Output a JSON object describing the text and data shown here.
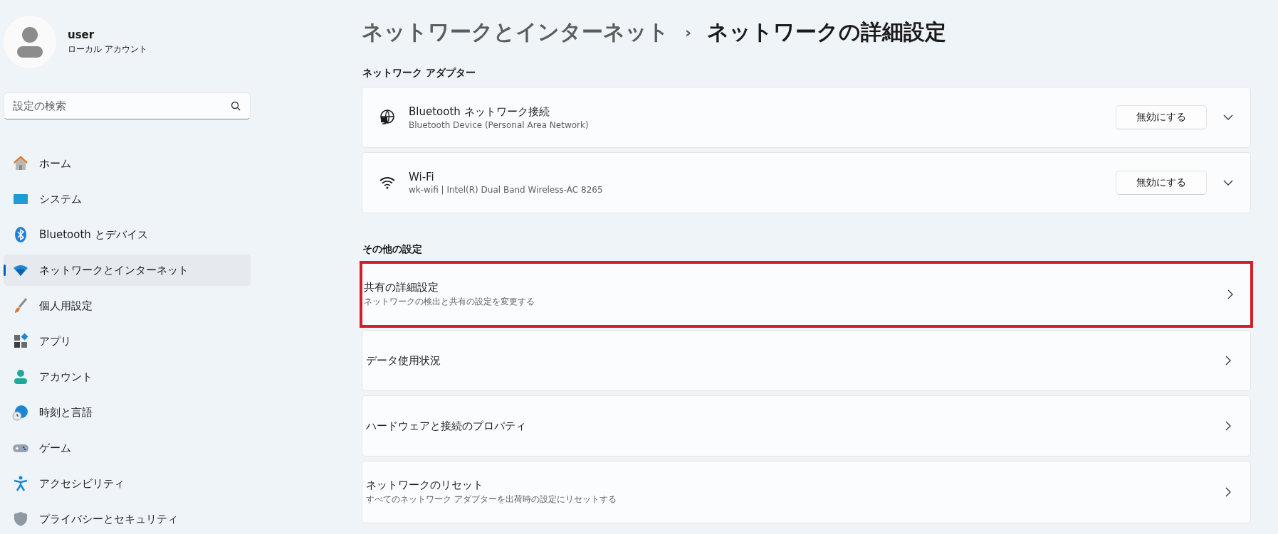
{
  "user": {
    "name": "user",
    "account": "ローカル アカウント"
  },
  "search": {
    "placeholder": "設定の検索"
  },
  "nav": [
    {
      "kind": "home",
      "label": "ホーム",
      "selected": false
    },
    {
      "kind": "system",
      "label": "システム",
      "selected": false
    },
    {
      "kind": "bluetooth",
      "label": "Bluetooth とデバイス",
      "selected": false
    },
    {
      "kind": "network",
      "label": "ネットワークとインターネット",
      "selected": true
    },
    {
      "kind": "brush",
      "label": "個人用設定",
      "selected": false
    },
    {
      "kind": "apps",
      "label": "アプリ",
      "selected": false
    },
    {
      "kind": "account",
      "label": "アカウント",
      "selected": false
    },
    {
      "kind": "time",
      "label": "時刻と言語",
      "selected": false
    },
    {
      "kind": "game",
      "label": "ゲーム",
      "selected": false
    },
    {
      "kind": "access",
      "label": "アクセシビリティ",
      "selected": false
    },
    {
      "kind": "shield",
      "label": "プライバシーとセキュリティ",
      "selected": false
    }
  ],
  "breadcrumb": {
    "parent": "ネットワークとインターネット",
    "separator": "›",
    "current": "ネットワークの詳細設定"
  },
  "adapters_heading": "ネットワーク アダプター",
  "adapters": [
    {
      "kind": "ethernet",
      "name": "Bluetooth ネットワーク接続",
      "description": "Bluetooth Device (Personal Area Network)",
      "button": "無効にする"
    },
    {
      "kind": "wifi",
      "name": "Wi-Fi",
      "description": "wk-wifi | Intel(R) Dual Band Wireless-AC 8265",
      "button": "無効にする"
    }
  ],
  "other_heading": "その他の設定",
  "other": [
    {
      "title": "共有の詳細設定",
      "description": "ネットワークの検出と共有の設定を変更する",
      "highlighted": true
    },
    {
      "title": "データ使用状況",
      "highlighted": false
    },
    {
      "title": "ハードウェアと接続のプロパティ",
      "highlighted": false
    },
    {
      "title": "ネットワークのリセット",
      "description": "すべてのネットワーク アダプターを出荷時の設定にリセットする",
      "highlighted": false
    }
  ]
}
